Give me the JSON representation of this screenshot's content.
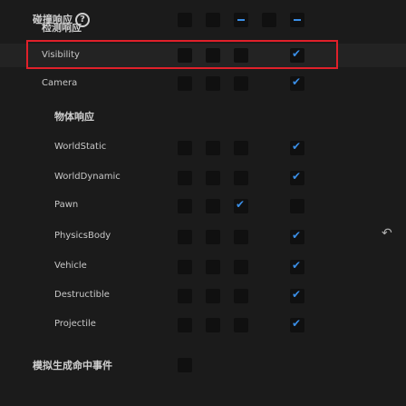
{
  "collision_response": {
    "title": "碰撞响应",
    "help_icon": "help-icon",
    "trace_header": "检测响应",
    "visibility_label": "Visibility",
    "camera_label": "Camera",
    "object_header": "物体响应",
    "rows": [
      {
        "label": "WorldStatic"
      },
      {
        "label": "WorldDynamic"
      },
      {
        "label": "Pawn"
      },
      {
        "label": "PhysicsBody"
      },
      {
        "label": "Vehicle"
      },
      {
        "label": "Destructible"
      },
      {
        "label": "Projectile"
      }
    ],
    "simulation_hit_events": "模拟生成命中事件",
    "reset_icon": "reset-arrow-icon",
    "accent_color": "#3a8ee6",
    "highlight_color": "#e0202a"
  }
}
